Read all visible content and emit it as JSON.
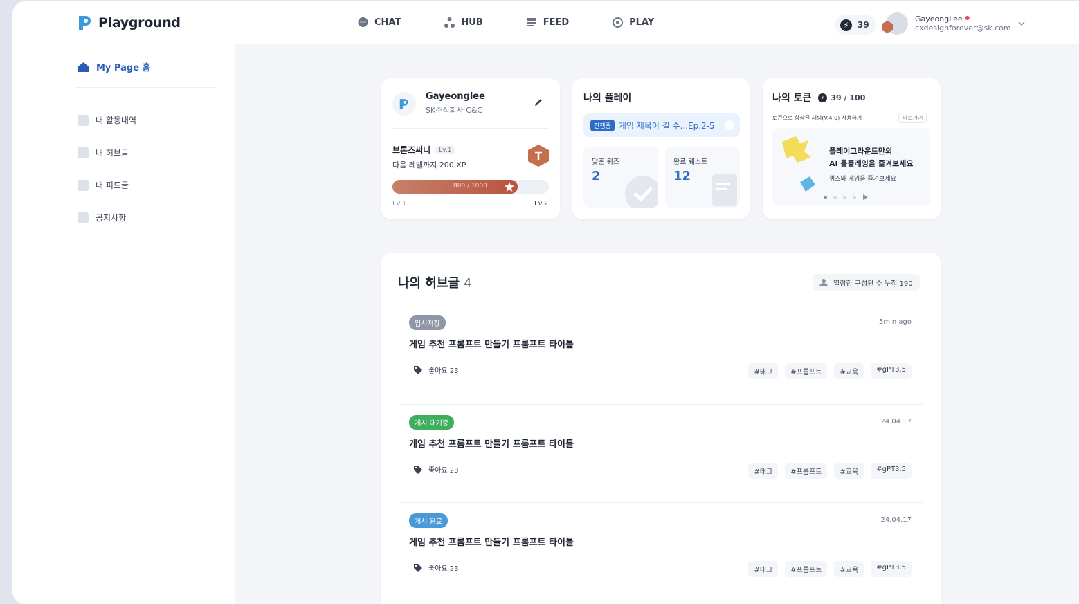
{
  "app": {
    "name": "Playground"
  },
  "nav": [
    {
      "label": "CHAT",
      "icon": "chat-icon"
    },
    {
      "label": "HUB",
      "icon": "hub-icon"
    },
    {
      "label": "FEED",
      "icon": "feed-icon"
    },
    {
      "label": "PLAY",
      "icon": "play-icon"
    }
  ],
  "header": {
    "tokens": "39",
    "user_name": "GayeongLee",
    "user_email": "cxdesignforever@sk.com"
  },
  "sidebar": {
    "home": "My Page 홈",
    "items": [
      {
        "label": "내 활동내역"
      },
      {
        "label": "내 허브글"
      },
      {
        "label": "내 피드글"
      },
      {
        "label": "공지사항"
      }
    ]
  },
  "profile": {
    "name": "Gayeonglee",
    "org": "SK주식회사 C&C",
    "grade": "브론즈써니",
    "grade_level": "Lv.1",
    "next_level": "다음 레벨까지 200 XP",
    "xp_text": "800 / 1000",
    "xp_progress": 0.8,
    "level_from": "Lv.1",
    "level_to": "Lv.2"
  },
  "play": {
    "title": "나의 플레이",
    "now_chip": "진행중",
    "now_title": "게임 제목이 길 수...Ep.2-5",
    "stats": [
      {
        "label": "맞춘 퀴즈",
        "value": "2"
      },
      {
        "label": "완료 퀘스트",
        "value": "12"
      }
    ]
  },
  "token": {
    "title": "나의 토큰",
    "count": "39 / 100",
    "sub": "토큰으로 향상된 채팅(V.4.0) 사용하기",
    "link": "바로가기",
    "banner_line1": "플레이그라운드만의",
    "banner_line2": "AI 롤플레잉을 즐겨보세요",
    "banner_line3": "퀴즈와 게임을 즐겨보세요"
  },
  "hub": {
    "title": "나의 허브글",
    "count": "4",
    "meta": "열람한 구성원 수  누적 190",
    "posts": [
      {
        "badge": "임시저장",
        "badge_color": "#8f96a6",
        "time": "5min ago",
        "title": "게임 추천 프롬프트 만들기 프롬프트 타이틀",
        "likes": "좋아요 23",
        "tags": [
          "#태그",
          "#프롬프트",
          "#교육",
          "#gPT3.5"
        ]
      },
      {
        "badge": "게시 대기중",
        "badge_color": "#3fae5e",
        "time": "24.04.17",
        "title": "게임 추천 프롬프트 만들기 프롬프트 타이틀",
        "likes": "좋아요 23",
        "tags": [
          "#태그",
          "#프롬프트",
          "#교육",
          "#gPT3.5"
        ]
      },
      {
        "badge": "게시 완료",
        "badge_color": "#4a9ad8",
        "time": "24.04.17",
        "title": "게임 추천 프롬프트 만들기 프롬프트 타이틀",
        "likes": "좋아요 23",
        "tags": [
          "#태그",
          "#프롬프트",
          "#교육",
          "#gPT3.5"
        ]
      }
    ]
  },
  "colors": {
    "accent": "#2d6bc4",
    "brand": "#3b9ad9",
    "xp_bar": "#b9533f",
    "medal": "#c4704f"
  }
}
